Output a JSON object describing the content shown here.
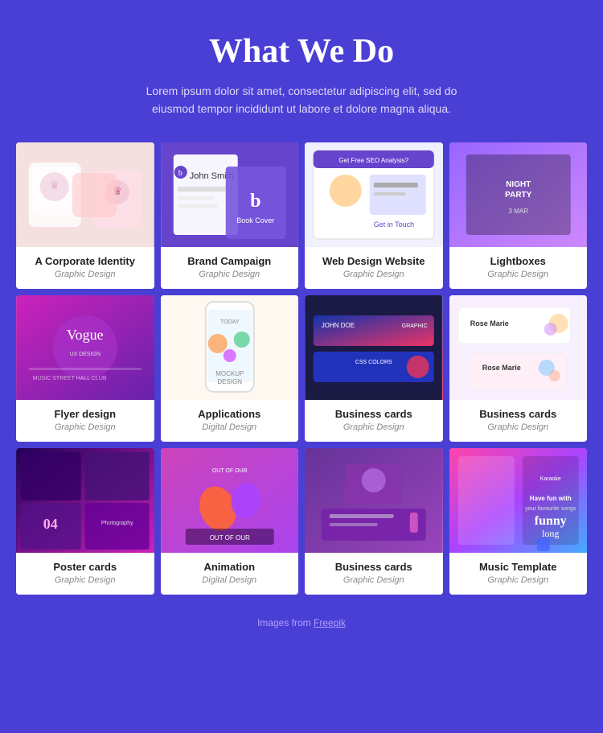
{
  "header": {
    "title": "What We Do",
    "subtitle": "Lorem ipsum dolor sit amet, consectetur adipiscing elit, sed do eiusmod tempor incididunt ut labore et dolore magna aliqua."
  },
  "grid": {
    "items": [
      {
        "id": "corporate",
        "title": "A Corporate Identity",
        "category": "Graphic Design",
        "img_class": "img-corporate"
      },
      {
        "id": "brand",
        "title": "Brand Campaign",
        "category": "Graphic Design",
        "img_class": "img-brand"
      },
      {
        "id": "webdesign",
        "title": "Web Design Website",
        "category": "Graphic Design",
        "img_class": "img-webdesign"
      },
      {
        "id": "lightboxes",
        "title": "Lightboxes",
        "category": "Graphic Design",
        "img_class": "img-lightboxes"
      },
      {
        "id": "flyer",
        "title": "Flyer design",
        "category": "Graphic Design",
        "img_class": "img-flyer"
      },
      {
        "id": "applications",
        "title": "Applications",
        "category": "Digital Design",
        "img_class": "img-applications"
      },
      {
        "id": "bizcard1",
        "title": "Business cards",
        "category": "Graphic Design",
        "img_class": "img-bizcard1"
      },
      {
        "id": "bizcard2",
        "title": "Business cards",
        "category": "Graphic Design",
        "img_class": "img-bizcard2"
      },
      {
        "id": "poster",
        "title": "Poster cards",
        "category": "Graphic Design",
        "img_class": "img-poster"
      },
      {
        "id": "animation",
        "title": "Animation",
        "category": "Digital Design",
        "img_class": "img-animation"
      },
      {
        "id": "bizcard3",
        "title": "Business cards",
        "category": "Graphic Design",
        "img_class": "img-bizcard3"
      },
      {
        "id": "music",
        "title": "Music Template",
        "category": "Graphic Design",
        "img_class": "img-music"
      }
    ]
  },
  "footer": {
    "credit_text": "Images from ",
    "credit_link": "Freepik"
  }
}
